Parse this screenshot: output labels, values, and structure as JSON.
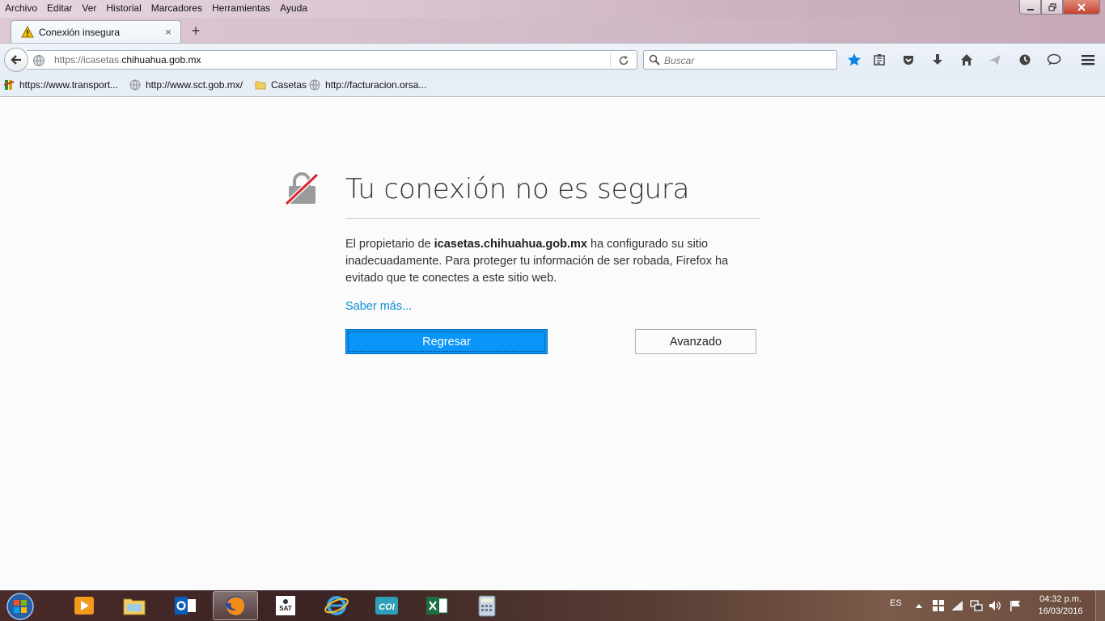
{
  "menu": [
    "Archivo",
    "Editar",
    "Ver",
    "Historial",
    "Marcadores",
    "Herramientas",
    "Ayuda"
  ],
  "tab": {
    "title": "Conexión insegura",
    "close": "×",
    "new_tab": "+"
  },
  "url": {
    "prefix": "https://icasetas.",
    "domain": "chihuahua.gob.mx"
  },
  "search": {
    "placeholder": "Buscar"
  },
  "bookmarks": [
    {
      "label": "https://www.transport..."
    },
    {
      "label": "http://www.sct.gob.mx/"
    },
    {
      "label": "Casetas"
    },
    {
      "label": "http://facturacion.orsa..."
    }
  ],
  "error": {
    "title": "Tu conexión no es segura",
    "desc_pre": "El propietario de ",
    "desc_host": "icasetas.chihuahua.gob.mx",
    "desc_post": " ha configurado su sitio inadecuadamente. Para proteger tu información de ser robada, Firefox ha evitado que te conectes a este sitio web.",
    "learn_more": "Saber más...",
    "back_button": "Regresar",
    "advanced_button": "Avanzado"
  },
  "taskbar": {
    "lang": "ES",
    "time": "04:32 p.m.",
    "date": "16/03/2016"
  },
  "colors": {
    "accent": "#0996f8",
    "link": "#0a8fd4",
    "warning": "#f2c200"
  }
}
